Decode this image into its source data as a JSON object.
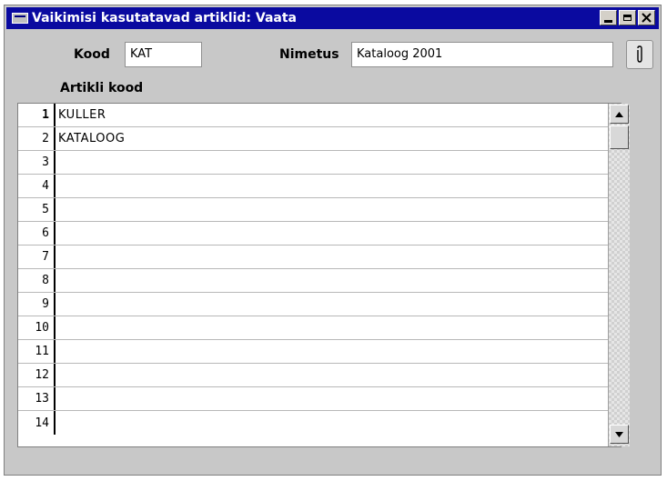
{
  "window": {
    "title": "Vaikimisi kasutatavad artiklid: Vaata"
  },
  "form": {
    "code_label": "Kood",
    "code_value": "KAT",
    "name_label": "Nimetus",
    "name_value": "Kataloog 2001"
  },
  "grid": {
    "column_header": "Artikli kood",
    "rows": [
      {
        "num": "1",
        "value": "KULLER"
      },
      {
        "num": "2",
        "value": "KATALOOG"
      },
      {
        "num": "3",
        "value": ""
      },
      {
        "num": "4",
        "value": ""
      },
      {
        "num": "5",
        "value": ""
      },
      {
        "num": "6",
        "value": ""
      },
      {
        "num": "7",
        "value": ""
      },
      {
        "num": "8",
        "value": ""
      },
      {
        "num": "9",
        "value": ""
      },
      {
        "num": "10",
        "value": ""
      },
      {
        "num": "11",
        "value": ""
      },
      {
        "num": "12",
        "value": ""
      },
      {
        "num": "13",
        "value": ""
      },
      {
        "num": "14",
        "value": ""
      }
    ]
  },
  "icons": {
    "attachment": "paperclip-icon",
    "minimize": "minimize-icon",
    "maximize": "maximize-icon",
    "close": "close-icon"
  },
  "colors": {
    "titlebar": "#0a0aa0",
    "window_bg": "#c8c8c8"
  }
}
